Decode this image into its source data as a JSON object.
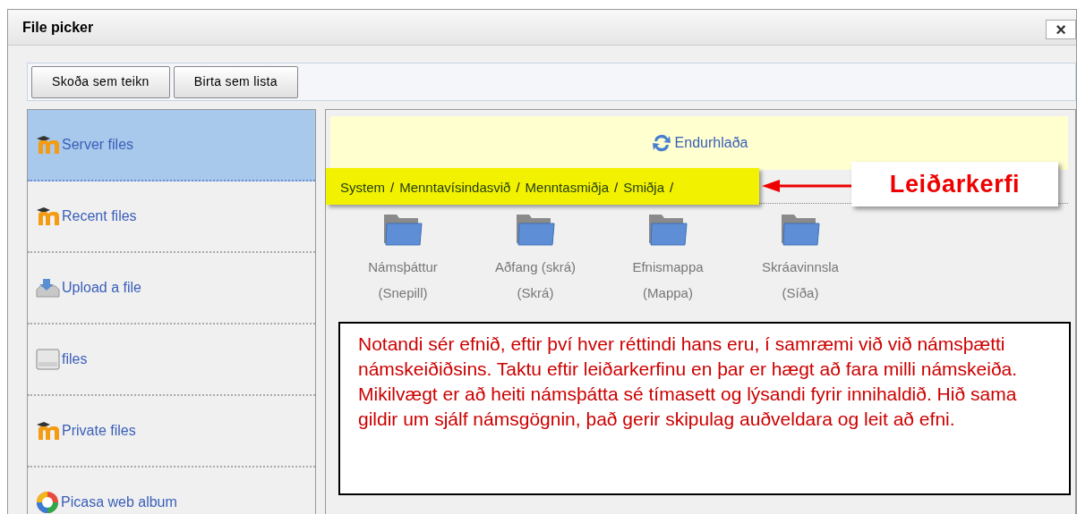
{
  "window": {
    "title": "File picker",
    "close": "×"
  },
  "toolbar": {
    "buttons": [
      "Skoða sem teikn",
      "Birta sem lista"
    ]
  },
  "sidebar": {
    "items": [
      {
        "label": "Server files",
        "kind": "moodle",
        "selected": true
      },
      {
        "label": "Recent files",
        "kind": "moodle",
        "selected": false
      },
      {
        "label": "Upload a file",
        "kind": "upload",
        "selected": false
      },
      {
        "label": "files",
        "kind": "drive",
        "selected": false
      },
      {
        "label": "Private files",
        "kind": "moodle",
        "selected": false
      },
      {
        "label": "Picasa web album",
        "kind": "picasa",
        "selected": false
      }
    ]
  },
  "main": {
    "refresh": "Endurhlaða",
    "breadcrumb": [
      "System",
      "Menntavísindasvið",
      "Menntasmiðja",
      "Smiðja"
    ],
    "separator": "/",
    "folders": [
      {
        "name": "Námsþáttur",
        "type": "(Snepill)"
      },
      {
        "name": "Aðfang (skrá)",
        "type": "(Skrá)"
      },
      {
        "name": "Efnismappa",
        "type": "(Mappa)"
      },
      {
        "name": "Skráavinnsla",
        "type": "(Síða)"
      }
    ]
  },
  "annotations": {
    "label": "Leiðarkerfi",
    "note": "Notandi sér efnið, eftir því hver réttindi hans eru, í samræmi við við námsþætti  námskeiðiðsins. Taktu eftir leiðarkerfinu en þar er hægt að fara milli námskeiða. Mikilvægt er að heiti námsþátta sé tímasett og lýsandi fyrir innihaldið. Hið sama gildir um sjálf námsgögnin, það gerir skipulag auðveldara og leit að efni."
  }
}
